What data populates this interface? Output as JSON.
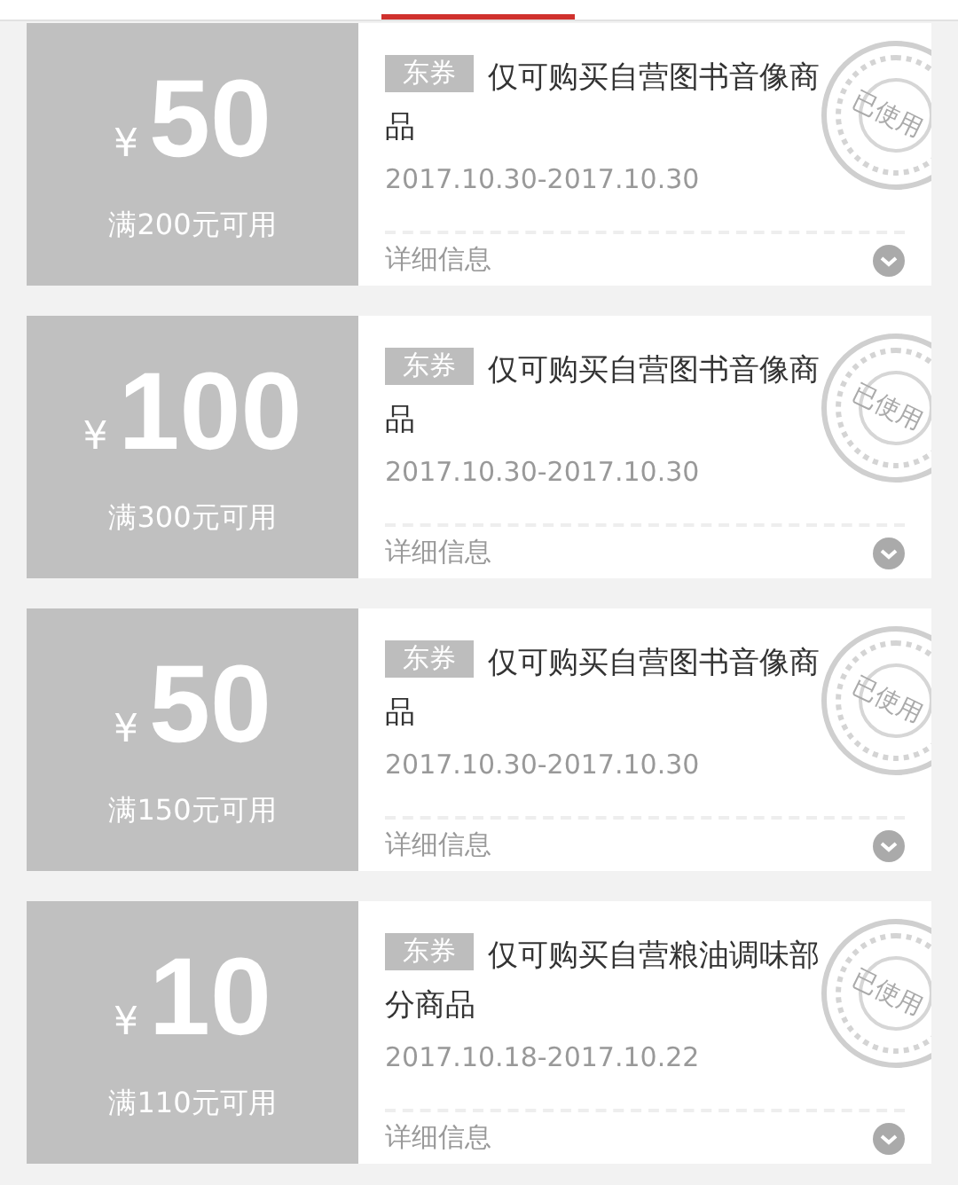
{
  "coupons": [
    {
      "currency": "¥",
      "amount": "50",
      "condition": "满200元可用",
      "tag": "东券",
      "title": "仅可购买自营图书音像商品",
      "dates": "2017.10.30-2017.10.30",
      "details_label": "详细信息",
      "used": true,
      "stamp_text": "已使用"
    },
    {
      "currency": "¥",
      "amount": "100",
      "condition": "满300元可用",
      "tag": "东券",
      "title": "仅可购买自营图书音像商品",
      "dates": "2017.10.30-2017.10.30",
      "details_label": "详细信息",
      "used": true,
      "stamp_text": "已使用"
    },
    {
      "currency": "¥",
      "amount": "50",
      "condition": "满150元可用",
      "tag": "东券",
      "title": "仅可购买自营图书音像商品",
      "dates": "2017.10.30-2017.10.30",
      "details_label": "详细信息",
      "used": true,
      "stamp_text": "已使用"
    },
    {
      "currency": "¥",
      "amount": "10",
      "condition": "满110元可用",
      "tag": "东券",
      "title": "仅可购买自营粮油调味部分商品",
      "dates": "2017.10.18-2017.10.22",
      "details_label": "详细信息",
      "used": true,
      "stamp_text": "已使用"
    }
  ]
}
